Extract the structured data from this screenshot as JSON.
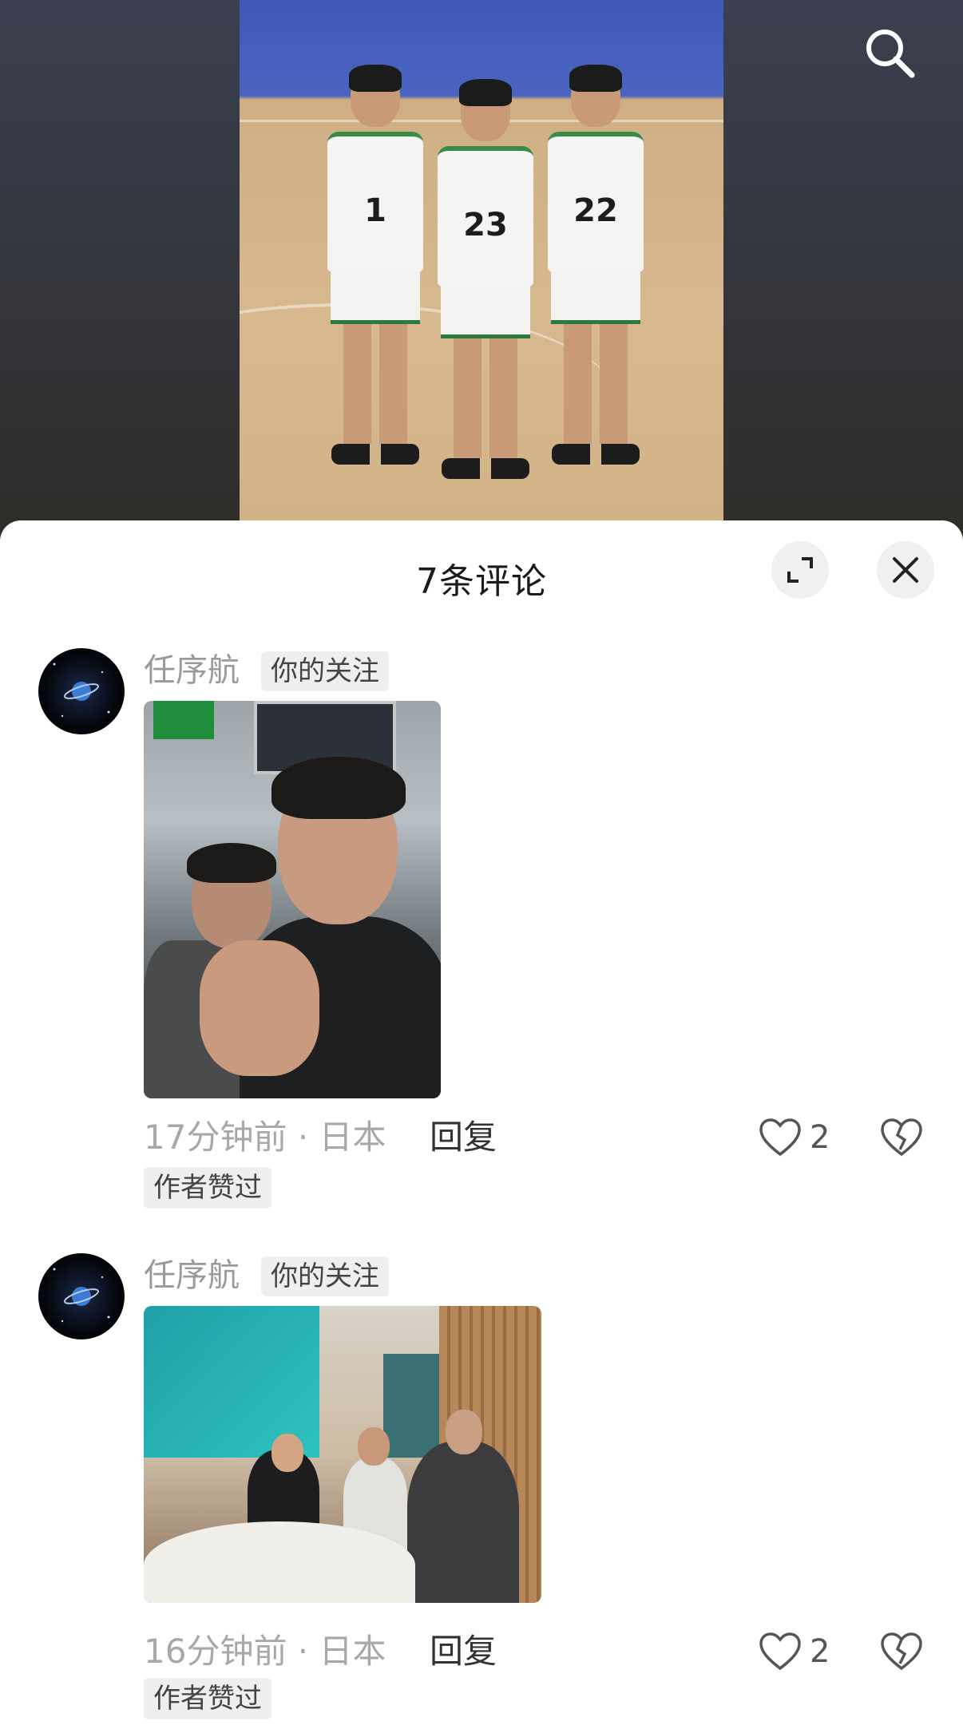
{
  "header": {
    "search_icon": "search-icon"
  },
  "sheet": {
    "title": "7条评论",
    "expand_icon": "expand-icon",
    "close_icon": "close-icon"
  },
  "hero": {
    "jersey_numbers": [
      "1",
      "23",
      "22"
    ]
  },
  "comments": [
    {
      "username": "任序航",
      "badge": "你的关注",
      "time_location": "17分钟前 · 日本",
      "reply_label": "回复",
      "likes": "2",
      "liked_tag": "作者赞过"
    },
    {
      "username": "任序航",
      "badge": "你的关注",
      "time_location": "16分钟前 · 日本",
      "reply_label": "回复",
      "likes": "2",
      "liked_tag": "作者赞过"
    }
  ]
}
